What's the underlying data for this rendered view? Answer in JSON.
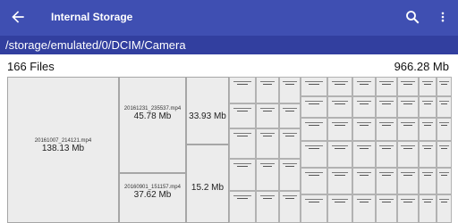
{
  "app": {
    "title": "Internal Storage",
    "path": "/storage/emulated/0/DCIM/Camera"
  },
  "summary": {
    "file_count": "166 Files",
    "total_size": "966.28 Mb"
  },
  "colors": {
    "appbar": "#3f4fb2",
    "pathbar": "#323f9f"
  },
  "icons": {
    "back": "arrow-left-icon",
    "search": "search-icon",
    "overflow": "more-vert-icon"
  },
  "treemap": {
    "tiles": [
      {
        "name": "20161007_214121.mp4",
        "size": "138.13 Mb"
      },
      {
        "name": "20161231_235537.mp4",
        "size": "45.78 Mb"
      },
      {
        "name": "20160901_151157.mp4",
        "size": "37.62 Mb"
      },
      {
        "name": "",
        "size": "33.93 Mb"
      },
      {
        "name": "",
        "size": "15.2 Mb"
      }
    ]
  }
}
